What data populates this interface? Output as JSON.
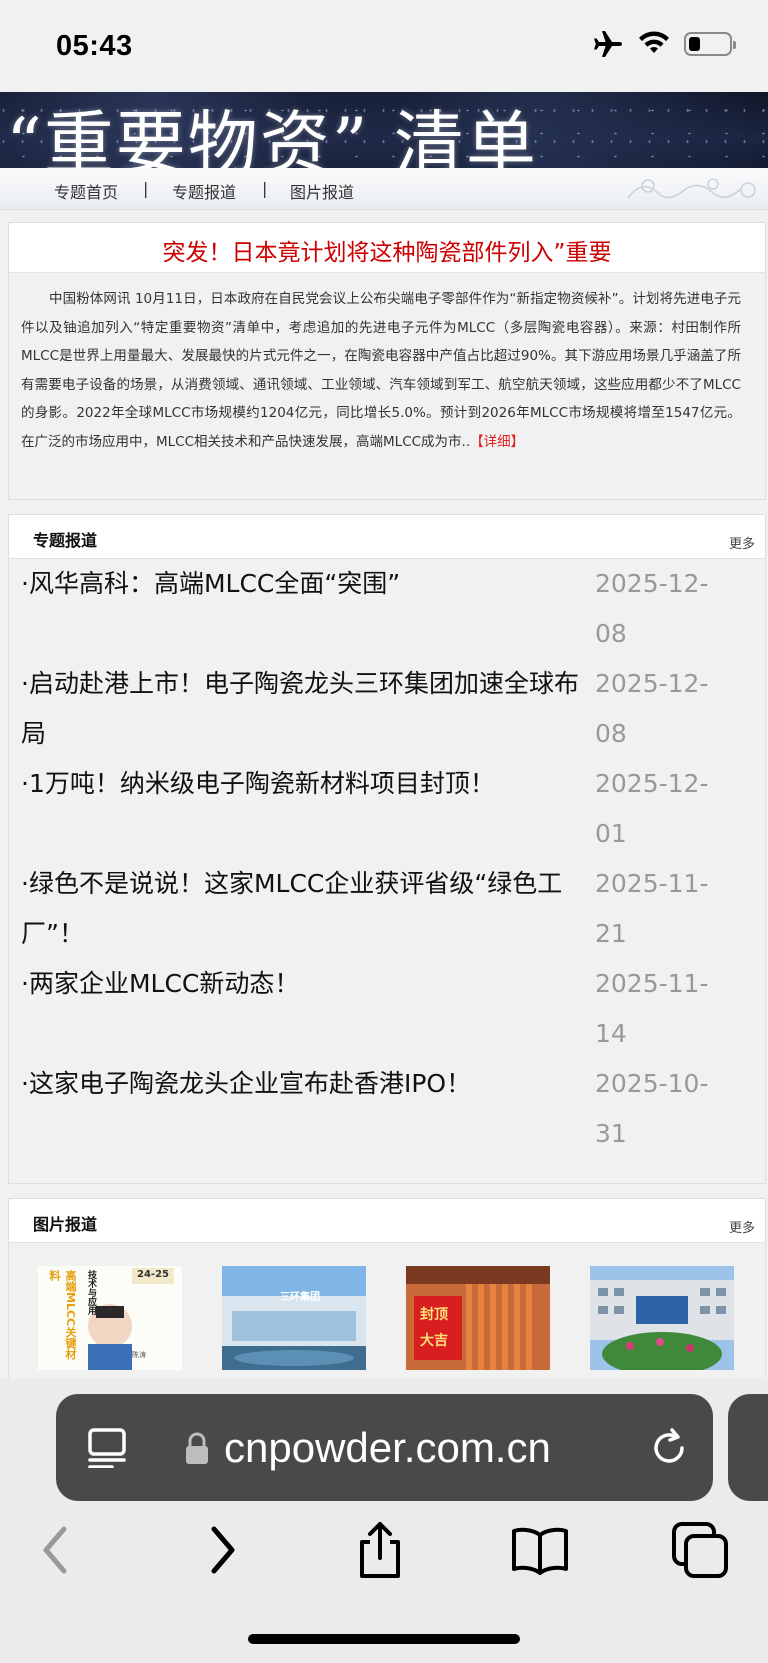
{
  "status_bar": {
    "time": "05:43",
    "battery_level": 0.3
  },
  "banner": {
    "title": "“重要物资” 清单"
  },
  "nav": {
    "items": [
      {
        "label": "专题首页"
      },
      {
        "label": "专题报道"
      },
      {
        "label": "图片报道"
      }
    ],
    "separator": "|"
  },
  "headline": {
    "title": "突发！日本竟计划将这种陶瓷部件列入”重要",
    "body": "中国粉体网讯 10月11日，日本政府在自民党会议上公布尖端电子零部件作为“新指定物资候补”。计划将先进电子元件以及铀追加列入“特定重要物资”清单中，考虑追加的先进电子元件为MLCC（多层陶瓷电容器）。来源：村田制作所MLCC是世界上用量最大、发展最快的片式元件之一，在陶瓷电容器中产值占比超过90%。其下游应用场景几乎涵盖了所有需要电子设备的场景，从消费领域、通讯领域、工业领域、汽车领域到军工、航空航天领域，这些应用都少不了MLCC的身影。2022年全球MLCC市场规模约1204亿元，同比增长5.0%。预计到2026年MLCC市场规模将增至1547亿元。在广泛的市场应用中，MLCC相关技术和产品快速发展，高端MLCC成为市..",
    "detail_link": "【详细】"
  },
  "special_reports": {
    "title": "专题报道",
    "more": "更多",
    "items": [
      {
        "title": "·风华高科：高端MLCC全面“突围”",
        "date_line1": "2025-12-",
        "date_line2": "08"
      },
      {
        "title": "·启动赴港上市！电子陶瓷龙头三环集团加速全球布局",
        "date_line1": "2025-12-",
        "date_line2": "08"
      },
      {
        "title": "·1万吨！纳米级电子陶瓷新材料项目封顶！",
        "date_line1": "2025-12-",
        "date_line2": "01"
      },
      {
        "title": "·绿色不是说说！这家MLCC企业获评省级“绿色工厂”！",
        "date_line1": "2025-11-",
        "date_line2": "21"
      },
      {
        "title": "·两家企业MLCC新动态！",
        "date_line1": "2025-11-",
        "date_line2": "14"
      },
      {
        "title": "·这家电子陶瓷龙头企业宣布赴香港IPO！",
        "date_line1": "2025-10-",
        "date_line2": "31"
      }
    ]
  },
  "photo_reports": {
    "title": "图片报道",
    "more": "更多",
    "photos": [
      {
        "caption_text_1": "技术与应用",
        "caption_text_2": "高端MLCC关键材料",
        "badge": "24-25",
        "person_name": "陈涛"
      },
      {
        "sign_text": "三环集团"
      },
      {
        "banner_text": "封顶大吉"
      },
      {
        "desc": "factory building with flowers"
      }
    ]
  },
  "safari": {
    "url": "cnpowder.com.cn"
  },
  "colors": {
    "headline_red": "#cc0000",
    "detail_red": "#e02020",
    "date_gray": "#999999",
    "url_bar": "#494949"
  }
}
